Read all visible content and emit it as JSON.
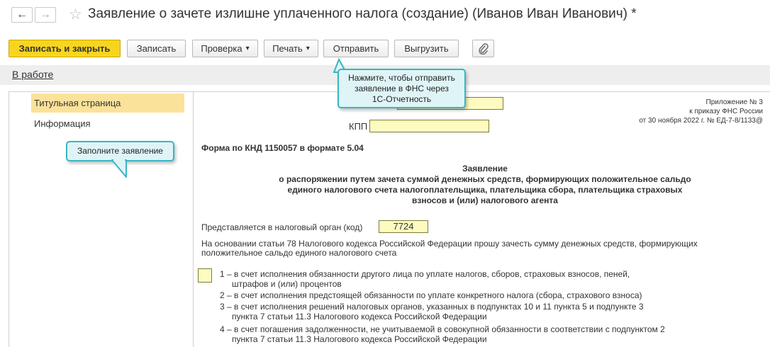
{
  "window": {
    "title": "Заявление о зачете излишне уплаченного налога (создание) (Иванов Иван Иванович) *",
    "back_icon": "←",
    "forward_icon": "→",
    "star_icon": "☆"
  },
  "toolbar": {
    "save_close": "Записать и закрыть",
    "save": "Записать",
    "check": "Проверка",
    "print": "Печать",
    "send": "Отправить",
    "export": "Выгрузить",
    "attach_icon": "paperclip-icon",
    "dropdown_arrow": "▾"
  },
  "status": {
    "label": "В работе"
  },
  "sidebar": {
    "items": [
      {
        "label": "Титульная страница"
      },
      {
        "label": "Информация"
      }
    ]
  },
  "tooltips": {
    "send_hint": [
      "Нажмите, чтобы отправить",
      "заявление в ФНС через",
      "1С-Отчетность"
    ],
    "fill_hint": "Заполните заявление"
  },
  "form": {
    "appendix": [
      "Приложение № 3",
      "к приказу ФНС России",
      "от 30 ноября 2022 г. №  ЕД-7-8/1133@"
    ],
    "kpp_label": "КПП",
    "form_code": "Форма по КНД 1150057 в формате 5.04",
    "heading": [
      "Заявление",
      "о распоряжении путем зачета суммой денежных средств, формирующих положительное сальдо",
      "единого налогового счета налогоплательщика, плательщика сбора, плательщика страховых",
      "взносов и (или) налогового агента"
    ],
    "tax_authority_label": "Представляется в налоговый орган (код)",
    "tax_authority_code": "7724",
    "basis": [
      "На основании статьи 78 Налогового кодекса Российской Федерации прошу зачесть сумму денежных средств, формирующих",
      "положительное сальдо единого налогового счета"
    ],
    "options": [
      "1 – в счет исполнения обязанности другого лица по уплате налогов, сборов, страховых взносов, пеней,",
      "штрафов и (или) процентов",
      "2 – в счет исполнения предстоящей обязанности по уплате конкретного налога (сбора, страхового взноса)",
      "3 – в счет исполнения решений налоговых органов, указанных в подпунктах 10 и 11 пункта 5 и подпункте 3",
      "пункта 7 статьи 11.3 Налогового кодекса Российской Федерации",
      "4 – в счет погашения задолженности, не учитываемой в совокупной обязанности в соответствии с подпунктом 2",
      "пункта 7 статьи 11.3 Налогового кодекса Российской Федерации"
    ]
  }
}
